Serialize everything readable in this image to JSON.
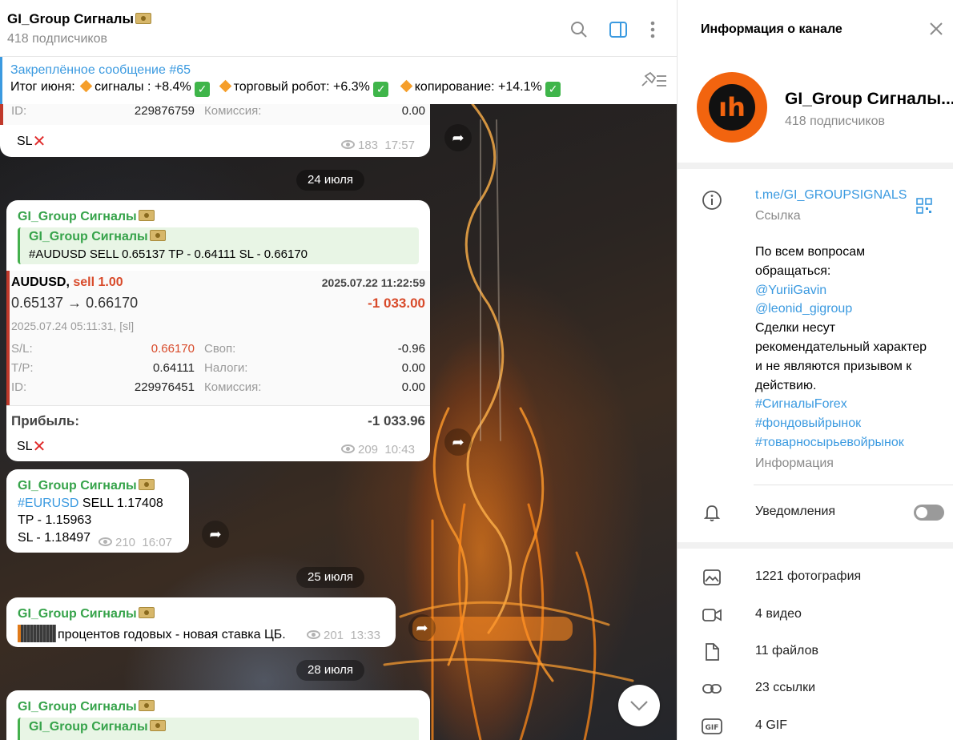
{
  "header": {
    "title": "GI_Group Сигналы",
    "subtitle": "418 подписчиков"
  },
  "pinned": {
    "title": "Закреплённое сообщение #65",
    "prefix": "Итог июня:",
    "item1": "сигналы : +8.4%",
    "item2": "торговый робот:  +6.3%",
    "item3": "копирование: +14.1%"
  },
  "msg0": {
    "id_label": "ID:",
    "id_value": "229876759",
    "comm_label": "Комиссия:",
    "comm_value": "0.00",
    "text": "SL",
    "views": "183",
    "time": "17:57"
  },
  "date1": "24 июля",
  "msg1": {
    "sender": "GI_Group Сигналы",
    "quote_sender": "GI_Group Сигналы",
    "quote_text": "#AUDUSD SELL 0.65137 TP - 0.64111 SL - 0.66170",
    "symbol": "AUDUSD,",
    "side": "sell 1.00",
    "opened": "2025.07.22 11:22:59",
    "prices": "0.65137 → 0.66170",
    "result": "-1 033.00",
    "closed": "2025.07.24 05:11:31, [sl]",
    "sl_label": "S/L:",
    "sl_value": "0.66170",
    "swap_label": "Своп:",
    "swap_value": "-0.96",
    "tp_label": "T/P:",
    "tp_value": "0.64111",
    "tax_label": "Налоги:",
    "tax_value": "0.00",
    "id_label": "ID:",
    "id_value": "229976451",
    "comm_label": "Комиссия:",
    "comm_value": "0.00",
    "profit_label": "Прибыль:",
    "profit_value": "-1 033.96",
    "text": "SL",
    "views": "209",
    "time": "10:43"
  },
  "msg2": {
    "sender": "GI_Group Сигналы",
    "hashtag": "#EURUSD",
    "line1": " SELL 1.17408",
    "line2": "TP - 1.15963",
    "line3": "SL - 1.18497",
    "views": "210",
    "time": "16:07"
  },
  "date2": "25 июля",
  "msg3": {
    "sender": "GI_Group Сигналы",
    "text": "процентов годовых - новая ставка ЦБ.",
    "views": "201",
    "time": "13:33"
  },
  "date3": "28 июля",
  "msg4": {
    "sender": "GI_Group Сигналы",
    "quote_sender": "GI_Group Сигналы"
  },
  "panel": {
    "title": "Информация о канале",
    "name": "GI_Group Сигналы...",
    "subscribers": "418 подписчиков",
    "link": "t.me/GI_GROUPSIGNALS",
    "link_label": "Ссылка",
    "desc1": "По всем вопросам",
    "desc2": "обращаться:",
    "contact1": "@YuriiGavin",
    "contact2": "@leonid_gigroup",
    "desc3": "Сделки несут",
    "desc4": "рекомендательный характер",
    "desc5": "и не являются призывом к",
    "desc6": "действию.",
    "tag1": "#СигналыForex",
    "tag2": "#фондовыйрынок",
    "tag3": "#товарносырьевойрынок",
    "info_label": "Информация",
    "notifications": "Уведомления",
    "notifications_on": false,
    "photos": "1221 фотография",
    "videos": "4 видео",
    "files": "11 файлов",
    "links": "23 ссылки",
    "gifs": "4 GIF"
  },
  "colors": {
    "accent": "#3b9ae0",
    "sender": "#36a34a",
    "loss": "#d84a2a",
    "logo": "#f2640f"
  }
}
